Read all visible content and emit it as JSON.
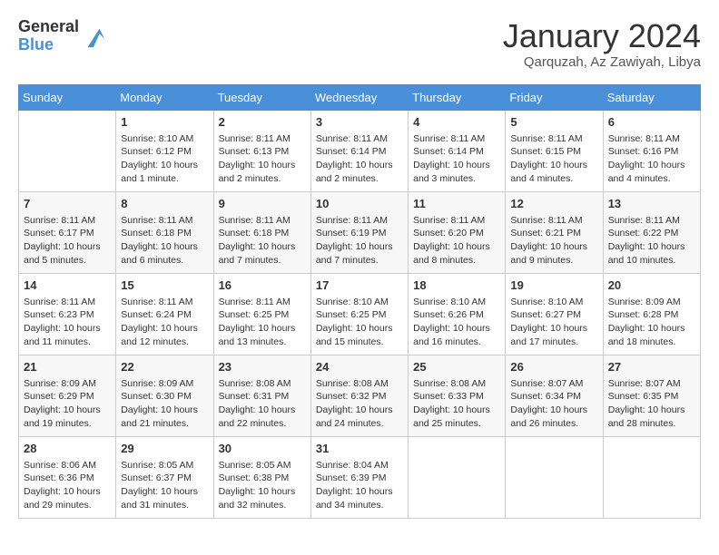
{
  "logo": {
    "general": "General",
    "blue": "Blue"
  },
  "title": "January 2024",
  "subtitle": "Qarquzah, Az Zawiyah, Libya",
  "calendar": {
    "headers": [
      "Sunday",
      "Monday",
      "Tuesday",
      "Wednesday",
      "Thursday",
      "Friday",
      "Saturday"
    ],
    "weeks": [
      [
        {
          "day": "",
          "info": ""
        },
        {
          "day": "1",
          "info": "Sunrise: 8:10 AM\nSunset: 6:12 PM\nDaylight: 10 hours\nand 1 minute."
        },
        {
          "day": "2",
          "info": "Sunrise: 8:11 AM\nSunset: 6:13 PM\nDaylight: 10 hours\nand 2 minutes."
        },
        {
          "day": "3",
          "info": "Sunrise: 8:11 AM\nSunset: 6:14 PM\nDaylight: 10 hours\nand 2 minutes."
        },
        {
          "day": "4",
          "info": "Sunrise: 8:11 AM\nSunset: 6:14 PM\nDaylight: 10 hours\nand 3 minutes."
        },
        {
          "day": "5",
          "info": "Sunrise: 8:11 AM\nSunset: 6:15 PM\nDaylight: 10 hours\nand 4 minutes."
        },
        {
          "day": "6",
          "info": "Sunrise: 8:11 AM\nSunset: 6:16 PM\nDaylight: 10 hours\nand 4 minutes."
        }
      ],
      [
        {
          "day": "7",
          "info": "Sunrise: 8:11 AM\nSunset: 6:17 PM\nDaylight: 10 hours\nand 5 minutes."
        },
        {
          "day": "8",
          "info": "Sunrise: 8:11 AM\nSunset: 6:18 PM\nDaylight: 10 hours\nand 6 minutes."
        },
        {
          "day": "9",
          "info": "Sunrise: 8:11 AM\nSunset: 6:18 PM\nDaylight: 10 hours\nand 7 minutes."
        },
        {
          "day": "10",
          "info": "Sunrise: 8:11 AM\nSunset: 6:19 PM\nDaylight: 10 hours\nand 7 minutes."
        },
        {
          "day": "11",
          "info": "Sunrise: 8:11 AM\nSunset: 6:20 PM\nDaylight: 10 hours\nand 8 minutes."
        },
        {
          "day": "12",
          "info": "Sunrise: 8:11 AM\nSunset: 6:21 PM\nDaylight: 10 hours\nand 9 minutes."
        },
        {
          "day": "13",
          "info": "Sunrise: 8:11 AM\nSunset: 6:22 PM\nDaylight: 10 hours\nand 10 minutes."
        }
      ],
      [
        {
          "day": "14",
          "info": "Sunrise: 8:11 AM\nSunset: 6:23 PM\nDaylight: 10 hours\nand 11 minutes."
        },
        {
          "day": "15",
          "info": "Sunrise: 8:11 AM\nSunset: 6:24 PM\nDaylight: 10 hours\nand 12 minutes."
        },
        {
          "day": "16",
          "info": "Sunrise: 8:11 AM\nSunset: 6:25 PM\nDaylight: 10 hours\nand 13 minutes."
        },
        {
          "day": "17",
          "info": "Sunrise: 8:10 AM\nSunset: 6:25 PM\nDaylight: 10 hours\nand 15 minutes."
        },
        {
          "day": "18",
          "info": "Sunrise: 8:10 AM\nSunset: 6:26 PM\nDaylight: 10 hours\nand 16 minutes."
        },
        {
          "day": "19",
          "info": "Sunrise: 8:10 AM\nSunset: 6:27 PM\nDaylight: 10 hours\nand 17 minutes."
        },
        {
          "day": "20",
          "info": "Sunrise: 8:09 AM\nSunset: 6:28 PM\nDaylight: 10 hours\nand 18 minutes."
        }
      ],
      [
        {
          "day": "21",
          "info": "Sunrise: 8:09 AM\nSunset: 6:29 PM\nDaylight: 10 hours\nand 19 minutes."
        },
        {
          "day": "22",
          "info": "Sunrise: 8:09 AM\nSunset: 6:30 PM\nDaylight: 10 hours\nand 21 minutes."
        },
        {
          "day": "23",
          "info": "Sunrise: 8:08 AM\nSunset: 6:31 PM\nDaylight: 10 hours\nand 22 minutes."
        },
        {
          "day": "24",
          "info": "Sunrise: 8:08 AM\nSunset: 6:32 PM\nDaylight: 10 hours\nand 24 minutes."
        },
        {
          "day": "25",
          "info": "Sunrise: 8:08 AM\nSunset: 6:33 PM\nDaylight: 10 hours\nand 25 minutes."
        },
        {
          "day": "26",
          "info": "Sunrise: 8:07 AM\nSunset: 6:34 PM\nDaylight: 10 hours\nand 26 minutes."
        },
        {
          "day": "27",
          "info": "Sunrise: 8:07 AM\nSunset: 6:35 PM\nDaylight: 10 hours\nand 28 minutes."
        }
      ],
      [
        {
          "day": "28",
          "info": "Sunrise: 8:06 AM\nSunset: 6:36 PM\nDaylight: 10 hours\nand 29 minutes."
        },
        {
          "day": "29",
          "info": "Sunrise: 8:05 AM\nSunset: 6:37 PM\nDaylight: 10 hours\nand 31 minutes."
        },
        {
          "day": "30",
          "info": "Sunrise: 8:05 AM\nSunset: 6:38 PM\nDaylight: 10 hours\nand 32 minutes."
        },
        {
          "day": "31",
          "info": "Sunrise: 8:04 AM\nSunset: 6:39 PM\nDaylight: 10 hours\nand 34 minutes."
        },
        {
          "day": "",
          "info": ""
        },
        {
          "day": "",
          "info": ""
        },
        {
          "day": "",
          "info": ""
        }
      ]
    ]
  }
}
